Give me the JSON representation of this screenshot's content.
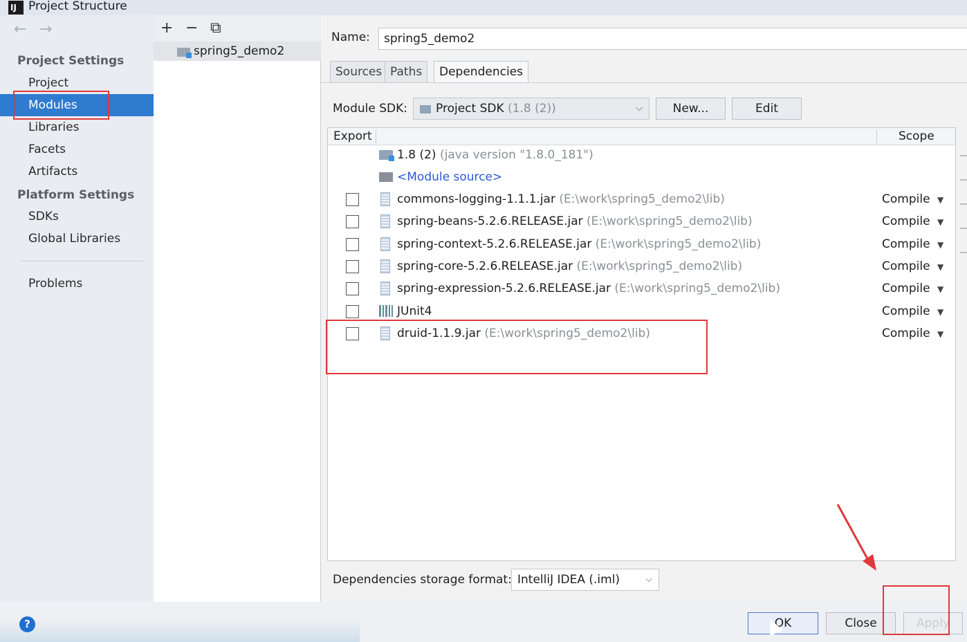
{
  "window": {
    "title": "Project Structure",
    "app_icon": "IJ"
  },
  "nav": {
    "back_icon": "←",
    "forward_icon": "→",
    "project_settings_header": "Project Settings",
    "project_settings": [
      "Project",
      "Modules",
      "Libraries",
      "Facets",
      "Artifacts"
    ],
    "platform_settings_header": "Platform Settings",
    "platform_settings": [
      "SDKs",
      "Global Libraries"
    ],
    "problems": "Problems",
    "selected": "Modules"
  },
  "module_list": {
    "add_icon": "+",
    "remove_icon": "−",
    "copy_icon": "⧉",
    "items": [
      "spring5_demo2"
    ]
  },
  "module": {
    "name_label": "Name:",
    "name_value": "spring5_demo2",
    "tabs": [
      "Sources",
      "Paths",
      "Dependencies"
    ],
    "active_tab": "Dependencies",
    "sdk_label": "Module SDK:",
    "sdk_value": "Project SDK",
    "sdk_version": "(1.8 (2))",
    "new_button": "New...",
    "edit_button": "Edit",
    "table": {
      "col_export": "Export",
      "col_scope": "Scope",
      "sdk_entry": {
        "name": "1.8 (2)",
        "detail": "(java version \"1.8.0_181\")"
      },
      "source_entry": "<Module source>",
      "deps": [
        {
          "name": "commons-logging-1.1.1.jar",
          "path": "(E:\\work\\spring5_demo2\\lib)",
          "scope": "Compile"
        },
        {
          "name": "spring-beans-5.2.6.RELEASE.jar",
          "path": "(E:\\work\\spring5_demo2\\lib)",
          "scope": "Compile"
        },
        {
          "name": "spring-context-5.2.6.RELEASE.jar",
          "path": "(E:\\work\\spring5_demo2\\lib)",
          "scope": "Compile"
        },
        {
          "name": "spring-core-5.2.6.RELEASE.jar",
          "path": "(E:\\work\\spring5_demo2\\lib)",
          "scope": "Compile"
        },
        {
          "name": "spring-expression-5.2.6.RELEASE.jar",
          "path": "(E:\\work\\spring5_demo2\\lib)",
          "scope": "Compile"
        },
        {
          "name": "JUnit4",
          "path": "",
          "scope": "Compile"
        },
        {
          "name": "druid-1.1.9.jar",
          "path": "(E:\\work\\spring5_demo2\\lib)",
          "scope": "Compile"
        }
      ]
    },
    "storage_label": "Dependencies storage format:",
    "storage_value": "IntelliJ IDEA (.iml)"
  },
  "footer": {
    "help_icon": "?",
    "ok_button": "OK",
    "close_button": "Close",
    "apply_button": "Apply"
  },
  "colors": {
    "selection": "#2f7bd0",
    "annotation_red": "#e0393b",
    "link_blue": "#2a5ad6"
  }
}
